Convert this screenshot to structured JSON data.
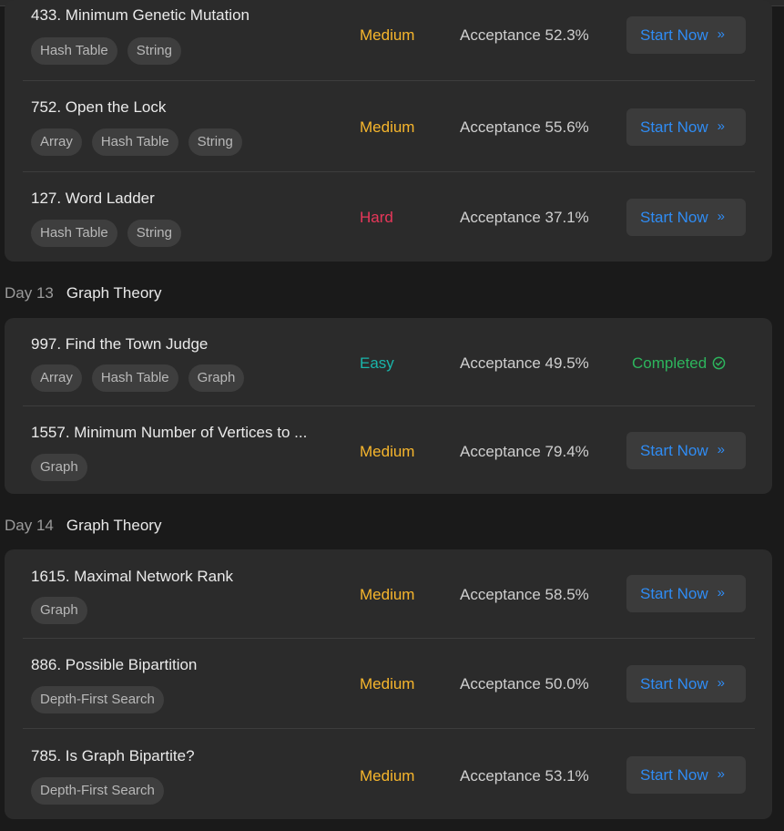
{
  "days": [
    {
      "day": "Day 13",
      "topic": "Graph Theory"
    },
    {
      "day": "Day 14",
      "topic": "Graph Theory"
    }
  ],
  "problems": [
    {
      "title": "433. Minimum Genetic Mutation",
      "tags": [
        "Hash Table",
        "String"
      ],
      "difficulty": "Medium",
      "acceptance": "Acceptance 52.3%",
      "action": "Start Now"
    },
    {
      "title": "752. Open the Lock",
      "tags": [
        "Array",
        "Hash Table",
        "String"
      ],
      "difficulty": "Medium",
      "acceptance": "Acceptance 55.6%",
      "action": "Start Now"
    },
    {
      "title": "127. Word Ladder",
      "tags": [
        "Hash Table",
        "String"
      ],
      "difficulty": "Hard",
      "acceptance": "Acceptance 37.1%",
      "action": "Start Now"
    },
    {
      "title": "997. Find the Town Judge",
      "tags": [
        "Array",
        "Hash Table",
        "Graph"
      ],
      "difficulty": "Easy",
      "acceptance": "Acceptance 49.5%",
      "action": "Completed"
    },
    {
      "title": "1557. Minimum Number of Vertices to ...",
      "tags": [
        "Graph"
      ],
      "difficulty": "Medium",
      "acceptance": "Acceptance 79.4%",
      "action": "Start Now"
    },
    {
      "title": "1615. Maximal Network Rank",
      "tags": [
        "Graph"
      ],
      "difficulty": "Medium",
      "acceptance": "Acceptance 58.5%",
      "action": "Start Now"
    },
    {
      "title": "886. Possible Bipartition",
      "tags": [
        "Depth-First Search"
      ],
      "difficulty": "Medium",
      "acceptance": "Acceptance 50.0%",
      "action": "Start Now"
    },
    {
      "title": "785. Is Graph Bipartite?",
      "tags": [
        "Depth-First Search"
      ],
      "difficulty": "Medium",
      "acceptance": "Acceptance 53.1%",
      "action": "Start Now"
    }
  ],
  "colors": {
    "medium": "#f7b62c",
    "hard": "#e8375a",
    "easy": "#19b6ab",
    "start_now": "#2f8cf4",
    "completed": "#2db55d"
  },
  "icons": {
    "start_now": "double-chevron-right-icon",
    "completed": "check-circle-icon"
  }
}
